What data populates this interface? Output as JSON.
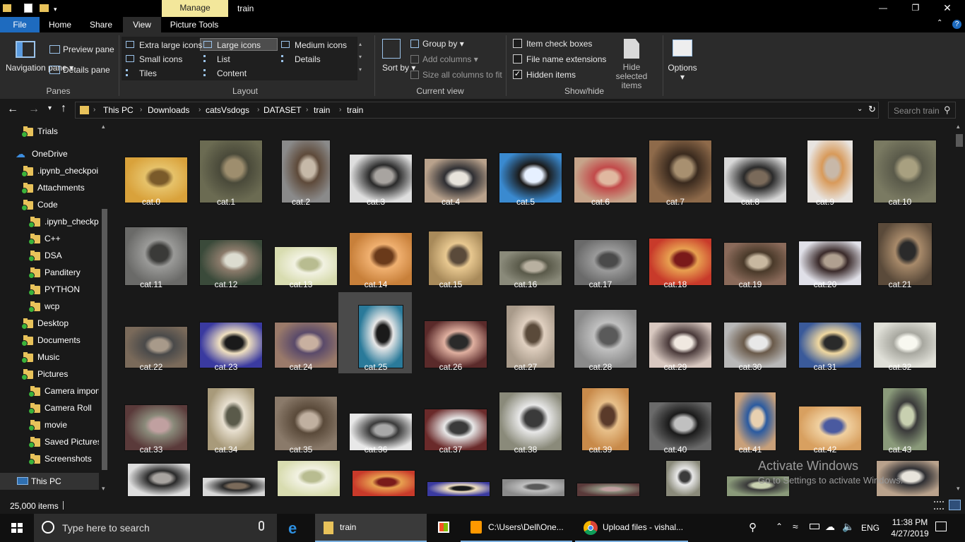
{
  "window": {
    "contextual_tab": "Manage",
    "title": "train",
    "controls": [
      "minimize",
      "restore",
      "close"
    ]
  },
  "ribbon_tabs": [
    "File",
    "Home",
    "Share",
    "View",
    "Picture Tools"
  ],
  "ribbon": {
    "panes": {
      "navigation_pane": "Navigation pane",
      "preview_pane": "Preview pane",
      "details_pane": "Details pane",
      "group": "Panes"
    },
    "layout": {
      "options": [
        "Extra large icons",
        "Large icons",
        "Medium icons",
        "Small icons",
        "List",
        "Details",
        "Tiles",
        "Content"
      ],
      "selected": "Large icons",
      "group": "Layout"
    },
    "current_view": {
      "sort_by": "Sort by",
      "group_by": "Group by",
      "add_columns": "Add columns",
      "size_columns": "Size all columns to fit",
      "group": "Current view"
    },
    "show_hide": {
      "item_check_boxes": {
        "label": "Item check boxes",
        "checked": false
      },
      "file_name_extensions": {
        "label": "File name extensions",
        "checked": false
      },
      "hidden_items": {
        "label": "Hidden items",
        "checked": true
      },
      "hide_selected": "Hide selected items",
      "group": "Show/hide"
    },
    "options": "Options"
  },
  "address": {
    "breadcrumb": [
      "This PC",
      "Downloads",
      "catsVsdogs",
      "DATASET",
      "train",
      "train"
    ],
    "search_placeholder": "Search train"
  },
  "nav_pane": {
    "items": [
      {
        "label": "Trials",
        "type": "folder"
      },
      {
        "label": "OneDrive",
        "type": "cloud"
      },
      {
        "label": ".ipynb_checkpoi",
        "type": "folder"
      },
      {
        "label": "Attachments",
        "type": "folder"
      },
      {
        "label": "Code",
        "type": "folder"
      },
      {
        "label": ".ipynb_checkpo",
        "type": "folder"
      },
      {
        "label": "C++",
        "type": "folder"
      },
      {
        "label": "DSA",
        "type": "folder"
      },
      {
        "label": "Panditery",
        "type": "folder"
      },
      {
        "label": "PYTHON",
        "type": "folder"
      },
      {
        "label": "wcp",
        "type": "folder"
      },
      {
        "label": "Desktop",
        "type": "folder"
      },
      {
        "label": "Documents",
        "type": "folder"
      },
      {
        "label": "Music",
        "type": "folder"
      },
      {
        "label": "Pictures",
        "type": "folder"
      },
      {
        "label": "Camera import",
        "type": "folder"
      },
      {
        "label": "Camera Roll",
        "type": "folder"
      },
      {
        "label": "movie",
        "type": "folder"
      },
      {
        "label": "Saved Pictures",
        "type": "folder"
      },
      {
        "label": "Screenshots",
        "type": "folder"
      },
      {
        "label": "This PC",
        "type": "pc"
      }
    ]
  },
  "files": [
    "cat.0",
    "cat.1",
    "cat.2",
    "cat.3",
    "cat.4",
    "cat.5",
    "cat.6",
    "cat.7",
    "cat.8",
    "cat.9",
    "cat.10",
    "cat.11",
    "cat.12",
    "cat.13",
    "cat.14",
    "cat.15",
    "cat.16",
    "cat.17",
    "cat.18",
    "cat.19",
    "cat.20",
    "cat.21",
    "cat.22",
    "cat.23",
    "cat.24",
    "cat.25",
    "cat.26",
    "cat.27",
    "cat.28",
    "cat.29",
    "cat.30",
    "cat.31",
    "cat.32",
    "cat.33",
    "cat.34",
    "cat.35",
    "cat.36",
    "cat.37",
    "cat.38",
    "cat.39",
    "cat.40",
    "cat.41",
    "cat.42",
    "cat.43"
  ],
  "selected_file": "cat.14",
  "watermark": {
    "line1": "Activate Windows",
    "line2": "Go to Settings to activate Windows."
  },
  "status": {
    "item_count": "25,000 items"
  },
  "taskbar": {
    "search_placeholder": "Type here to search",
    "apps": [
      {
        "label": "train",
        "icon": "folder-icon"
      },
      {
        "label": "C:\\Users\\Dell\\One...",
        "icon": "sublime-icon"
      },
      {
        "label": "Upload files - vishal...",
        "icon": "chrome-icon"
      }
    ],
    "language": "ENG",
    "time": "11:38 PM",
    "date": "4/27/2019"
  }
}
